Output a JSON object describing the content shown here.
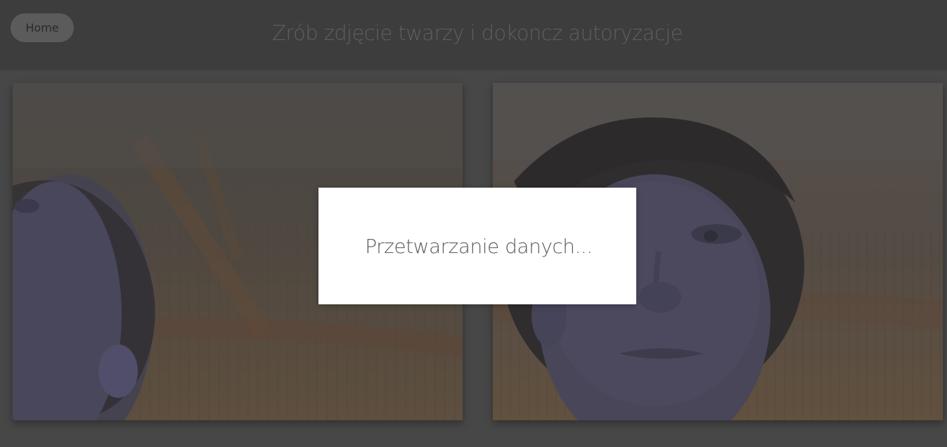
{
  "header": {
    "home_label": "Home",
    "title": "Zrób zdjęcie twarzy i dokoncz autoryzacje"
  },
  "camera": {
    "left_feed_icon": "camera-preview",
    "right_feed_icon": "captured-photo"
  },
  "modal": {
    "message": "Przetwarzanie danych..."
  },
  "colors": {
    "background": "#474747",
    "header": "#3d3d3d",
    "modal": "#ffffff"
  }
}
